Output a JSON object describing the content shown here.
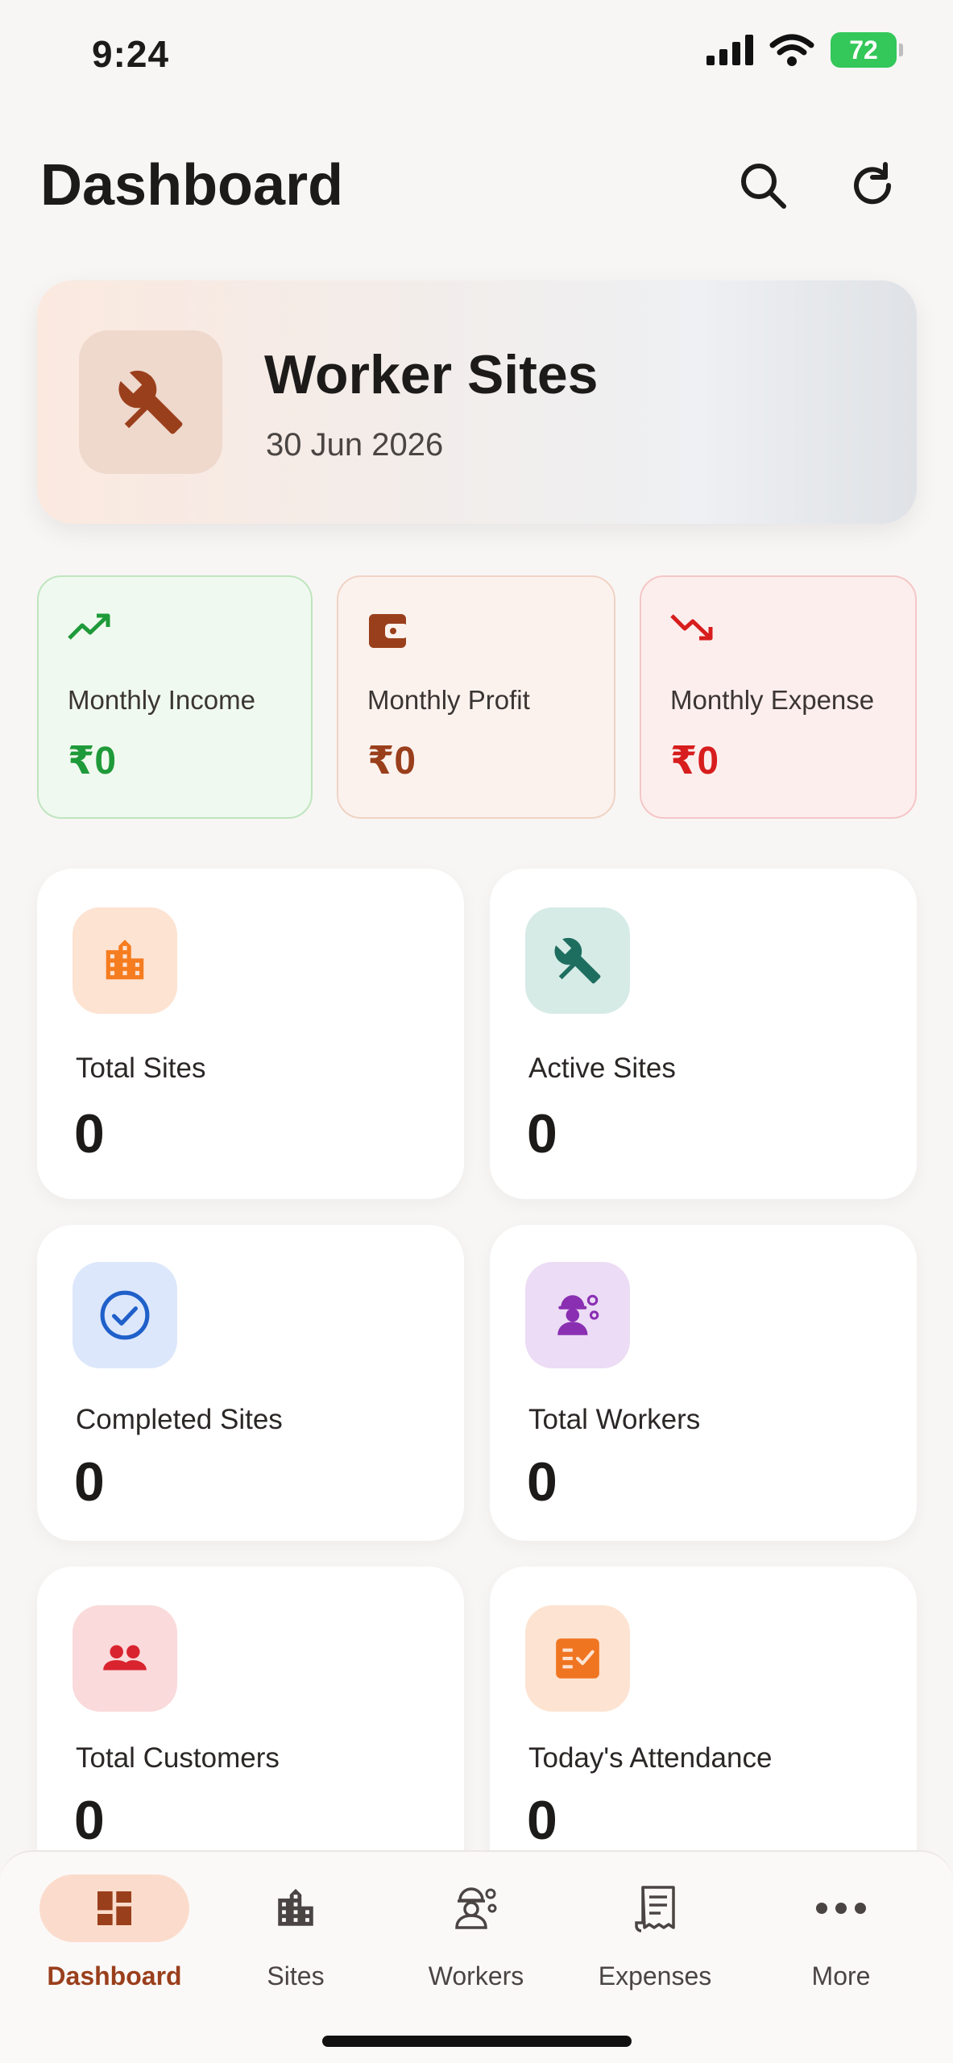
{
  "status_bar": {
    "time": "9:24",
    "battery": "72"
  },
  "header": {
    "title": "Dashboard"
  },
  "hero": {
    "title": "Worker Sites",
    "date": "30 Jun 2026"
  },
  "finance": [
    {
      "label": "Monthly Income",
      "value": "₹0",
      "color": "#1f9a3a",
      "icon": "trending-up-icon"
    },
    {
      "label": "Monthly Profit",
      "value": "₹0",
      "color": "#9a3f1c",
      "icon": "wallet-icon"
    },
    {
      "label": "Monthly Expense",
      "value": "₹0",
      "color": "#d71d1d",
      "icon": "trending-down-icon"
    }
  ],
  "stats": [
    {
      "label": "Total Sites",
      "value": "0",
      "icon": "buildings-icon",
      "color": "#f57c1f"
    },
    {
      "label": "Active Sites",
      "value": "0",
      "icon": "tools-icon",
      "color": "#1e6e60"
    },
    {
      "label": "Completed Sites",
      "value": "0",
      "icon": "check-circle-icon",
      "color": "#1f5fc9"
    },
    {
      "label": "Total Workers",
      "value": "0",
      "icon": "worker-icon",
      "color": "#8a2fb2"
    },
    {
      "label": "Total Customers",
      "value": "0",
      "icon": "people-icon",
      "color": "#d9232e"
    },
    {
      "label": "Today's Attendance",
      "value": "0",
      "icon": "checklist-icon",
      "color": "#f07521"
    }
  ],
  "nav": [
    {
      "label": "Dashboard",
      "icon": "dashboard-icon",
      "active": true
    },
    {
      "label": "Sites",
      "icon": "buildings-icon",
      "active": false
    },
    {
      "label": "Workers",
      "icon": "worker-icon",
      "active": false
    },
    {
      "label": "Expenses",
      "icon": "receipt-icon",
      "active": false
    },
    {
      "label": "More",
      "icon": "more-icon",
      "active": false
    }
  ]
}
